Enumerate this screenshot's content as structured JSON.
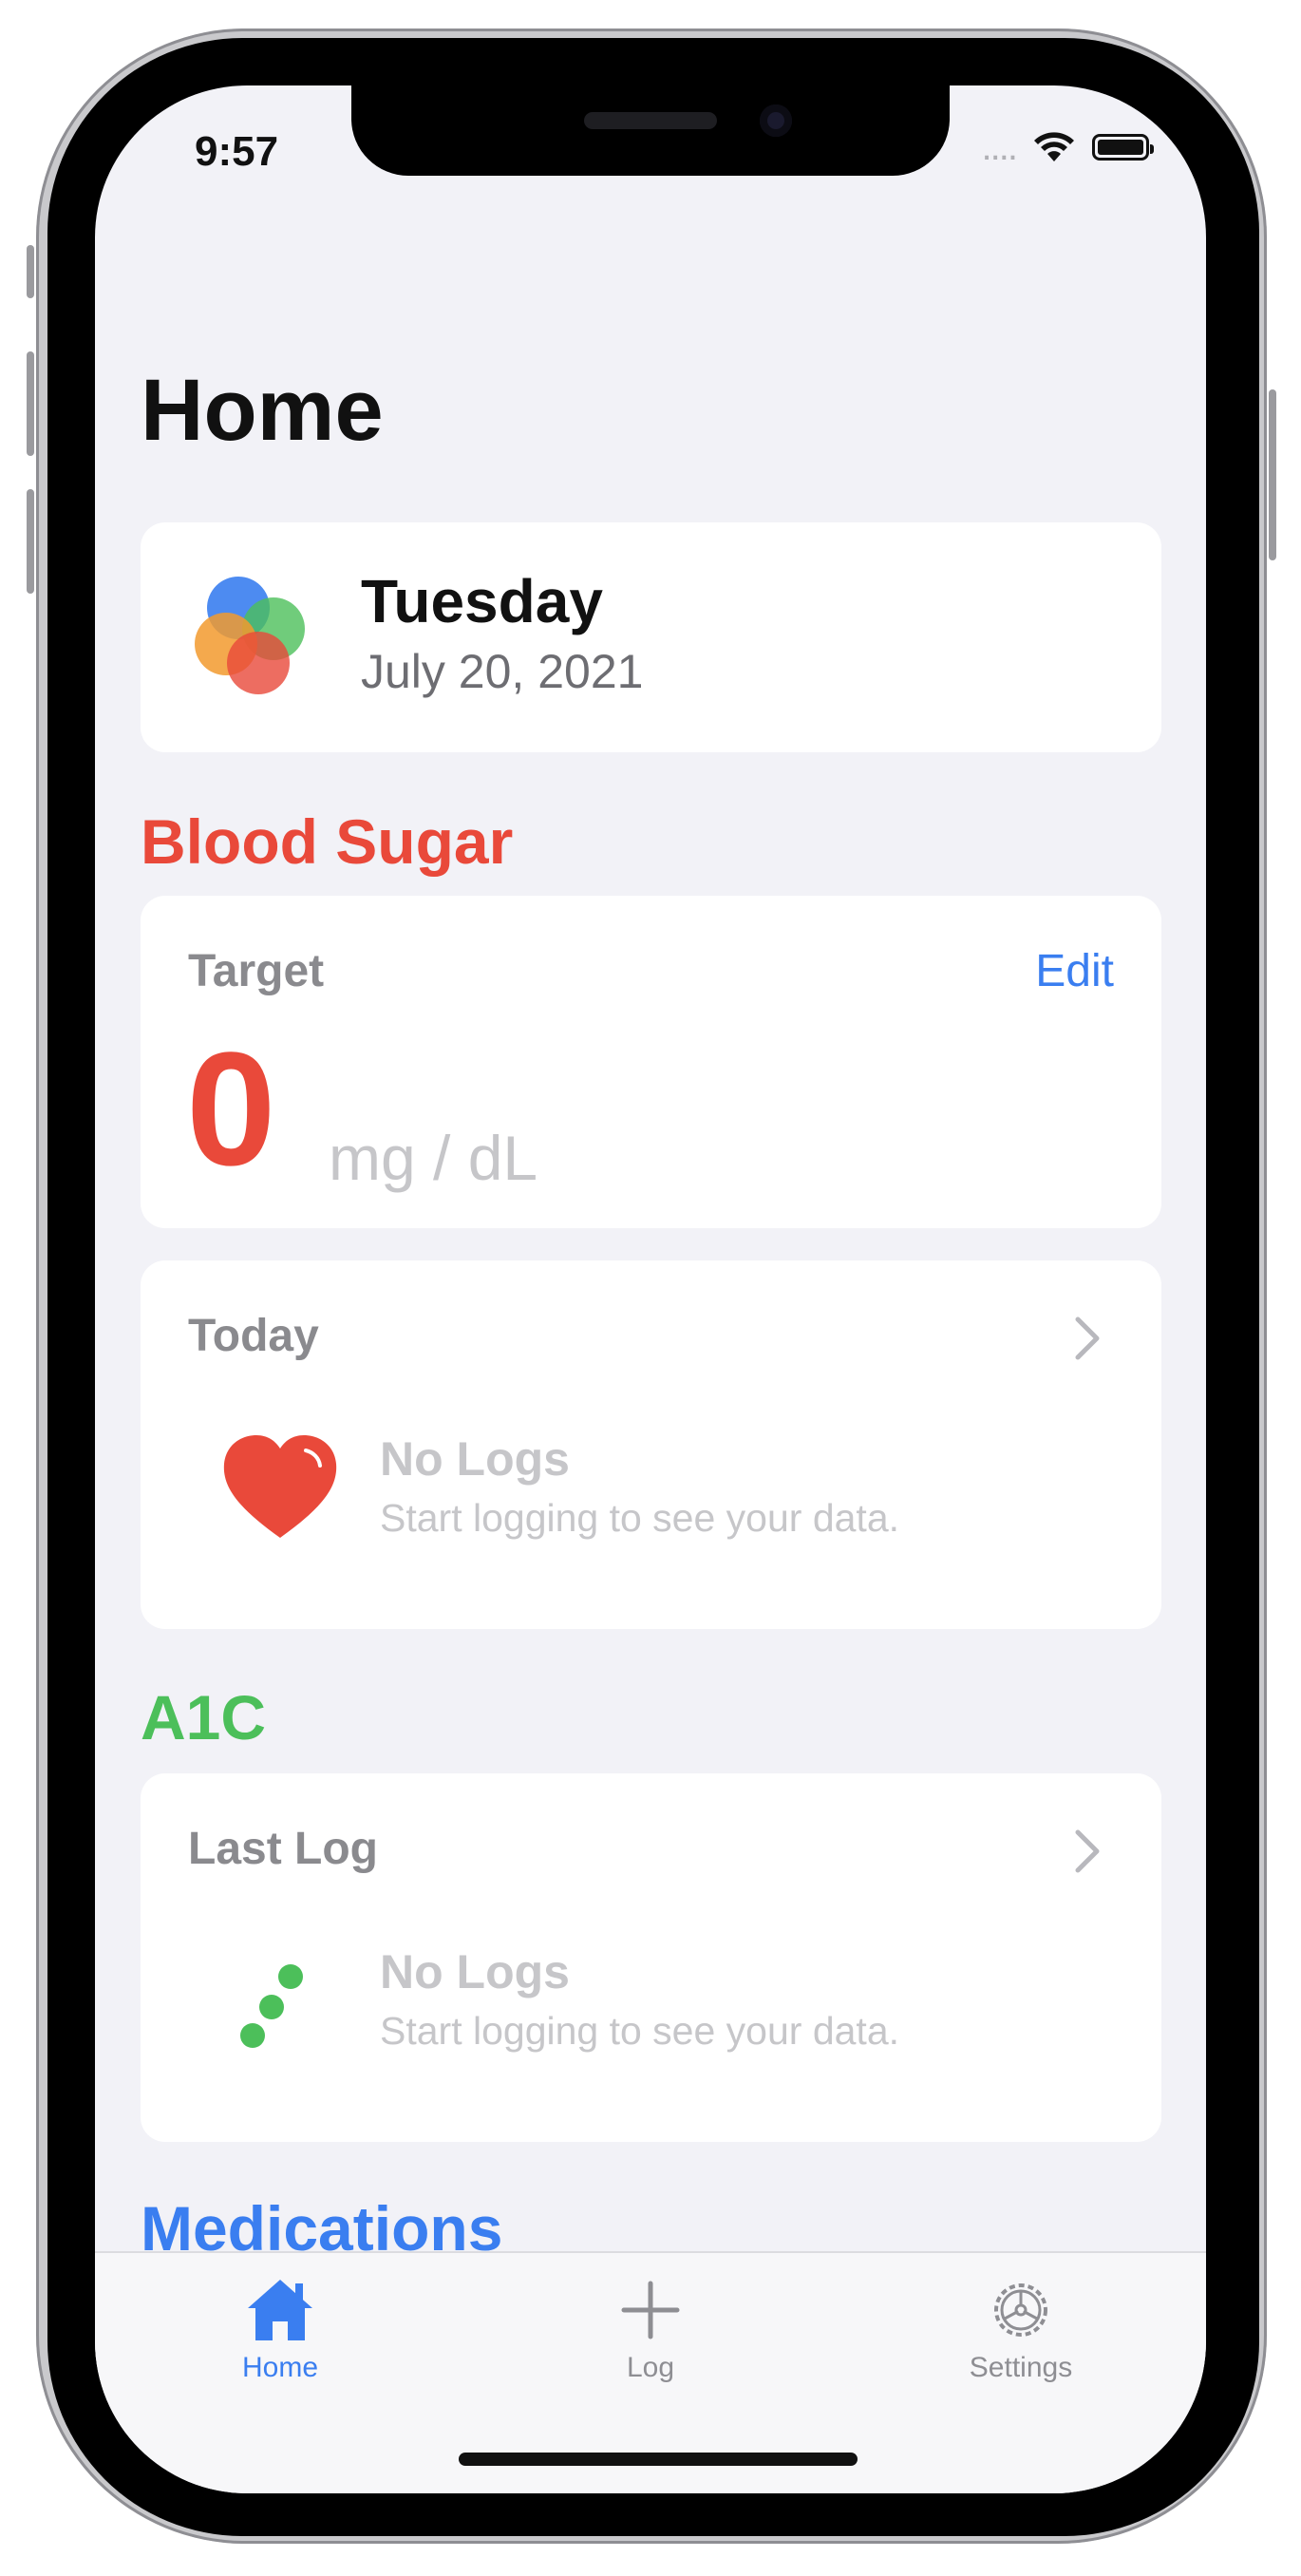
{
  "status_bar": {
    "time": "9:57",
    "signal": "....",
    "wifi_icon": "wifi-icon",
    "battery_icon": "battery-icon"
  },
  "header": {
    "title": "Home"
  },
  "date_card": {
    "logo_icon": "overlapping-circles-logo",
    "day": "Tuesday",
    "date": "July 20, 2021"
  },
  "blood_sugar": {
    "title": "Blood Sugar",
    "color": "#e9493a",
    "target": {
      "label": "Target",
      "edit_label": "Edit",
      "value": "0",
      "unit": "mg / dL"
    },
    "today": {
      "label": "Today",
      "icon": "heart-icon",
      "empty_title": "No Logs",
      "empty_subtitle": "Start logging to see your data."
    }
  },
  "a1c": {
    "title": "A1C",
    "color": "#4cbf5a",
    "last_log": {
      "label": "Last Log",
      "icon": "dots-trend-icon",
      "empty_title": "No Logs",
      "empty_subtitle": "Start logging to see your data."
    }
  },
  "medications": {
    "title": "Medications",
    "color": "#3a7ef0"
  },
  "tab_bar": {
    "tabs": [
      {
        "label": "Home",
        "icon": "house-icon",
        "selected": true
      },
      {
        "label": "Log",
        "icon": "plus-icon",
        "selected": false
      },
      {
        "label": "Settings",
        "icon": "gear-icon",
        "selected": false
      }
    ],
    "accent": "#3a7ef0"
  }
}
